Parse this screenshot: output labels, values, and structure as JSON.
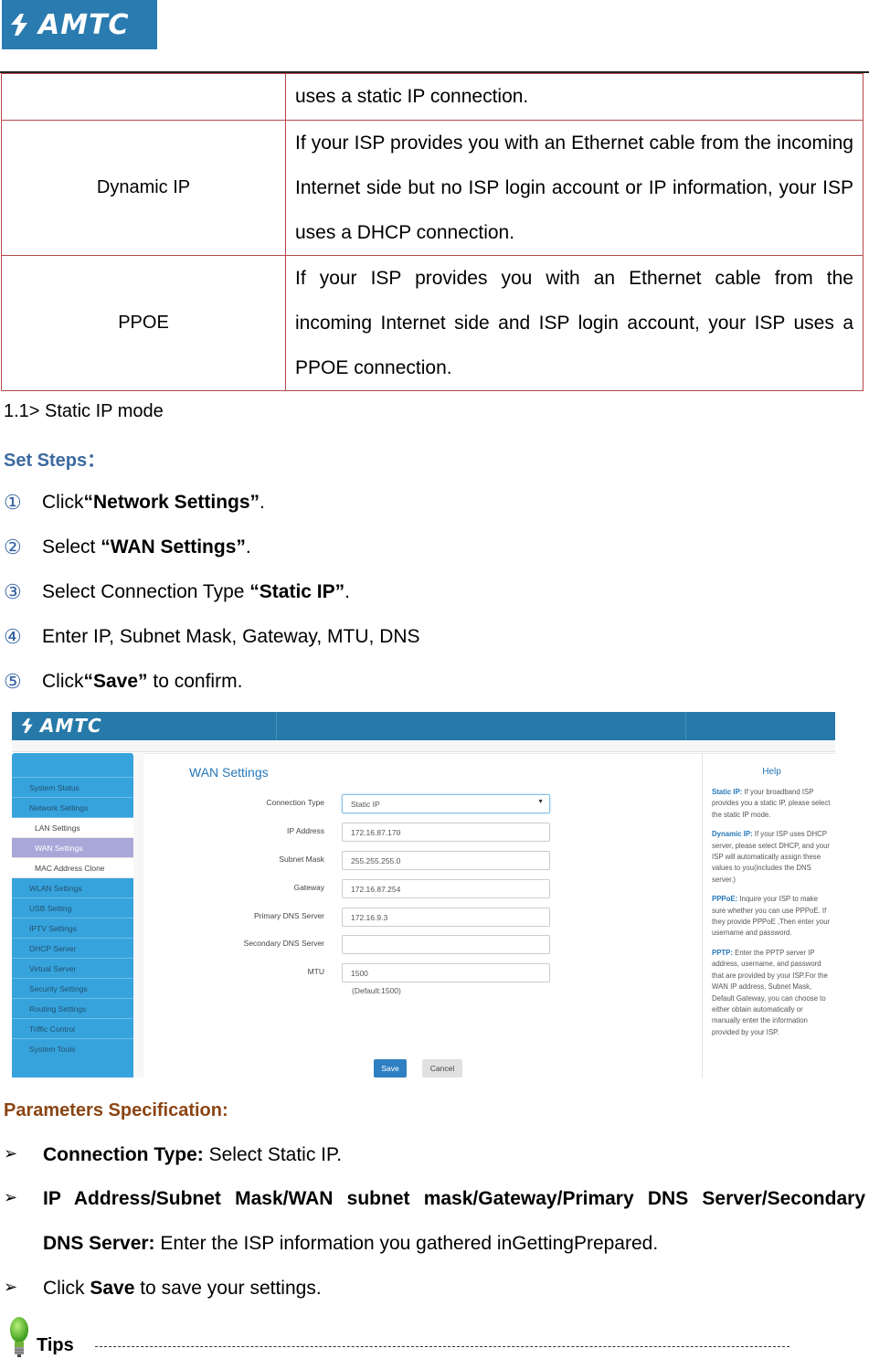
{
  "document": {
    "logo_text": "AMTC",
    "connection_table": [
      {
        "type": "",
        "description": "uses a static IP connection."
      },
      {
        "type": "Dynamic IP",
        "description_lines": [
          "If your ISP provides you with an Ethernet cable from the incoming",
          "Internet side but no ISP login account or IP information, your ISP",
          "uses a DHCP connection."
        ]
      },
      {
        "type": "PPOE",
        "description_lines": [
          "If your ISP provides you with an Ethernet cable from the",
          "incoming Internet side and ISP login account, your ISP uses a",
          "PPOE connection."
        ]
      }
    ],
    "section_label": "1.1> Static IP mode",
    "steps_heading": "Set Steps：",
    "steps": [
      {
        "num": "①",
        "prefix": "Click",
        "bold": "“Network Settings”",
        "suffix": "."
      },
      {
        "num": "②",
        "prefix": "Select ",
        "bold": "“WAN Settings”",
        "suffix": "."
      },
      {
        "num": "③",
        "prefix": "Select Connection Type ",
        "bold": "“Static IP”",
        "suffix": "."
      },
      {
        "num": "④",
        "prefix": "Enter IP, Subnet Mask, Gateway, MTU, DNS",
        "bold": "",
        "suffix": ""
      },
      {
        "num": "⑤",
        "prefix": "Click",
        "bold": "“Save”",
        "suffix": " to confirm."
      }
    ],
    "params_heading": "Parameters Specification:",
    "params": [
      {
        "bold": "Connection Type:",
        "text": " Select Static IP."
      },
      {
        "bold": "IP Address/Subnet Mask/WAN subnet mask/Gateway/Primary DNS Server/Secondary",
        "bold2": "DNS Server:",
        "text": " Enter the ISP information you gathered inGettingPrepared."
      },
      {
        "prefix": "Click ",
        "bold": "Save",
        "text": " to save your settings."
      }
    ],
    "bullet_glyph": "➢",
    "tips_label": "Tips"
  },
  "router_ui": {
    "logo_text": "AMTC",
    "sidebar": [
      {
        "label": "System Status",
        "type": "main"
      },
      {
        "label": "Network Settings",
        "type": "main"
      },
      {
        "label": "LAN Settings",
        "type": "sub"
      },
      {
        "label": "WAN Settings",
        "type": "sub-active"
      },
      {
        "label": "MAC Address Clone",
        "type": "sub"
      },
      {
        "label": "WLAN Settings",
        "type": "main"
      },
      {
        "label": "USB Setting",
        "type": "main"
      },
      {
        "label": "IPTV Settings",
        "type": "main"
      },
      {
        "label": "DHCP Server",
        "type": "main"
      },
      {
        "label": "Virtual Server",
        "type": "main"
      },
      {
        "label": "Security Settings",
        "type": "main"
      },
      {
        "label": "Routing Settings",
        "type": "main"
      },
      {
        "label": "Triffic Control",
        "type": "main"
      },
      {
        "label": "System Tools",
        "type": "main"
      }
    ],
    "page_title": "WAN Settings",
    "form": {
      "connection_type": {
        "label": "Connection Type",
        "value": "Static IP"
      },
      "ip_address": {
        "label": "IP Address",
        "value": "172.16.87.170"
      },
      "subnet_mask": {
        "label": "Subnet Mask",
        "value": "255.255.255.0"
      },
      "gateway": {
        "label": "Gateway",
        "value": "172.16.87.254"
      },
      "primary_dns": {
        "label": "Primary DNS Server",
        "value": "172.16.9.3"
      },
      "secondary_dns": {
        "label": "Secondary DNS Server",
        "value": ""
      },
      "mtu": {
        "label": "MTU",
        "value": "1500",
        "hint": "(Default:1500)"
      }
    },
    "buttons": {
      "save": "Save",
      "cancel": "Cancel"
    },
    "help": {
      "title": "Help",
      "items": [
        {
          "term": "Static IP:",
          "text": " If your broadband ISP provides you a static IP, please select the static IP mode."
        },
        {
          "term": "Dynamic IP:",
          "text": " If your ISP uses DHCP server, please select DHCP, and your ISP will automatically assign these values to you(includes the DNS server.)"
        },
        {
          "term": "PPPoE:",
          "text": " Inquire your ISP to make sure whether you can use PPPoE. If they provide PPPoE ,Then enter your username and password."
        },
        {
          "term": "PPTP:",
          "text": " Enter the PPTP server IP address, username, and password that are provided by your ISP.For the WAN IP address, Subnet Mask, Default Gateway, you can choose to either obtain automatically or manually enter the information provided by your ISP."
        }
      ]
    },
    "colors": {
      "topbar": "#2679a8",
      "sidebar": "#36a3dc",
      "active_item": "#a9a7d8",
      "accent": "#2677b8",
      "save_button": "#2f80c2"
    }
  }
}
